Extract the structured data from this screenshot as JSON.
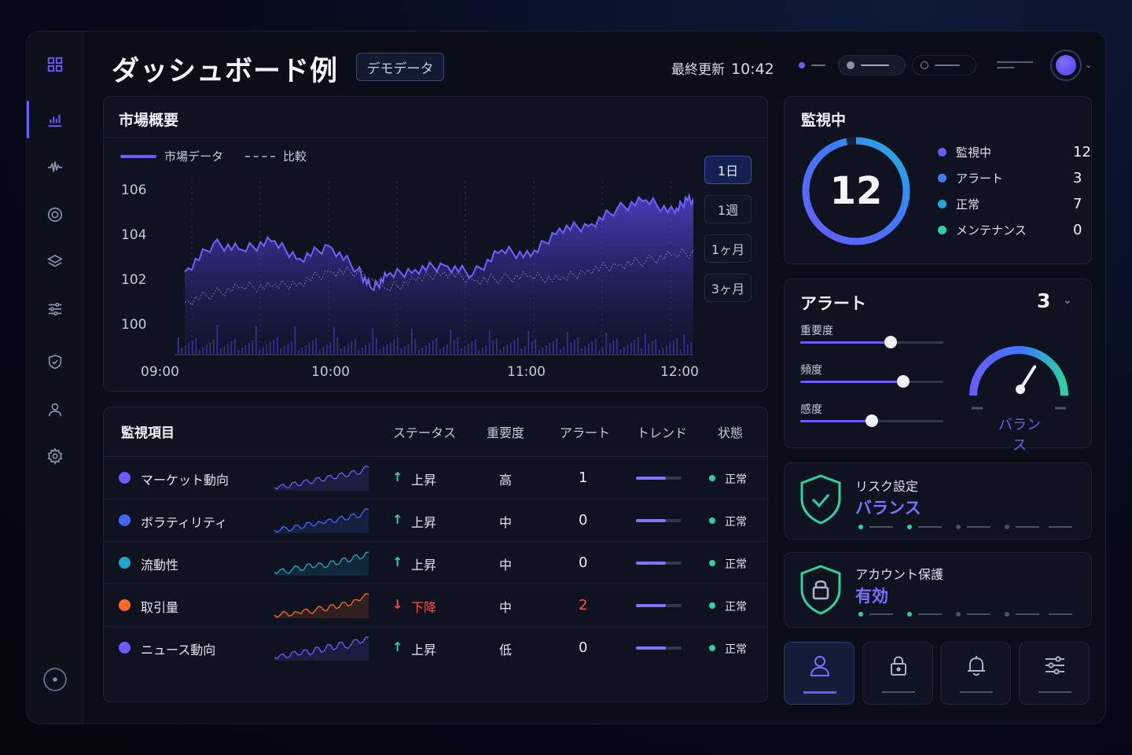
{
  "header": {
    "title": "ダッシュボード例",
    "badge": "デモデータ",
    "updated_label": "最終更新",
    "updated_time": "10:42"
  },
  "market": {
    "title": "市場概要",
    "legend": [
      {
        "label": "市場データ",
        "color": "#6a5cff"
      },
      {
        "label": "比較",
        "color": "#8a90a8"
      }
    ],
    "ranges": [
      "1日",
      "1週",
      "1ヶ月",
      "3ヶ月"
    ],
    "active_range": "1日"
  },
  "chart_data": {
    "type": "area",
    "x_ticks": [
      "09:00",
      "10:00",
      "11:00",
      "12:00"
    ],
    "y_ticks": [
      "100",
      "102",
      "104",
      "106"
    ],
    "ylim": [
      98.6,
      107.2
    ],
    "grid": true,
    "legend_position": "top-left",
    "series": [
      {
        "name": "市場データ",
        "color": "#6a5cff",
        "x": [
          "09:00",
          "09:10",
          "09:20",
          "09:30",
          "09:40",
          "09:50",
          "10:00",
          "10:05",
          "10:10",
          "10:20",
          "10:30",
          "10:40",
          "10:50",
          "11:00",
          "11:10",
          "11:20",
          "11:30",
          "11:40",
          "11:50",
          "11:55",
          "12:00",
          "12:05"
        ],
        "values": [
          102.3,
          103.6,
          103.3,
          103.7,
          102.9,
          103.5,
          102.4,
          101.5,
          102.1,
          102.4,
          102.6,
          102.2,
          103.3,
          103.0,
          104.3,
          104.4,
          105.2,
          105.6,
          105.0,
          105.8,
          104.5,
          105.1
        ]
      },
      {
        "name": "比較",
        "color": "#8a90a8",
        "x": [
          "09:00",
          "09:10",
          "09:20",
          "09:30",
          "09:40",
          "09:50",
          "10:00",
          "10:10",
          "10:20",
          "10:30",
          "10:40",
          "10:50",
          "11:00",
          "11:10",
          "11:20",
          "11:30",
          "11:40",
          "11:50",
          "12:00",
          "12:05"
        ],
        "values": [
          100.9,
          101.3,
          101.6,
          101.6,
          101.8,
          102.3,
          102.3,
          101.5,
          101.9,
          102.3,
          101.9,
          102.0,
          102.1,
          101.9,
          102.4,
          102.6,
          102.8,
          103.1,
          103.2,
          103.8
        ]
      }
    ]
  },
  "table": {
    "title": "監視項目",
    "headers": [
      "ステータス",
      "重要度",
      "アラート",
      "トレンド",
      "状態"
    ],
    "rows": [
      {
        "name": "マーケット動向",
        "color": "#6a5cff",
        "arrow": "↑",
        "status": "上昇",
        "status_color": "#e6e9f2",
        "arrow_color": "#2ed1a4",
        "importance": "高",
        "alerts": "1",
        "alert_color": "#e6e9f2",
        "state": "正常",
        "spark": [
          3,
          4,
          3,
          5,
          4,
          6,
          5,
          7,
          6,
          8,
          7,
          9,
          8,
          10,
          9,
          11,
          12
        ]
      },
      {
        "name": "ボラティリティ",
        "color": "#4466ff",
        "arrow": "↑",
        "status": "上昇",
        "status_color": "#e6e9f2",
        "arrow_color": "#2ed1a4",
        "importance": "中",
        "alerts": "0",
        "alert_color": "#e6e9f2",
        "state": "正常",
        "spark": [
          3,
          3,
          4,
          3,
          5,
          4,
          6,
          5,
          6,
          7,
          6,
          8,
          7,
          9,
          8,
          10,
          11
        ]
      },
      {
        "name": "流動性",
        "color": "#1fa6c9",
        "arrow": "↑",
        "status": "上昇",
        "status_color": "#e6e9f2",
        "arrow_color": "#2ed1a4",
        "importance": "中",
        "alerts": "0",
        "alert_color": "#e6e9f2",
        "state": "正常",
        "spark": [
          3,
          4,
          3,
          4,
          5,
          4,
          6,
          5,
          6,
          5,
          7,
          6,
          8,
          7,
          9,
          8,
          10
        ]
      },
      {
        "name": "取引量",
        "color": "#ff6a2a",
        "arrow": "↓",
        "status": "下降",
        "status_color": "#ff4d4d",
        "arrow_color": "#ff4d4d",
        "importance": "中",
        "alerts": "2",
        "alert_color": "#ff4d4d",
        "state": "正常",
        "spark": [
          3,
          3,
          4,
          3,
          4,
          5,
          4,
          5,
          6,
          5,
          7,
          6,
          8,
          7,
          9,
          10,
          11
        ]
      },
      {
        "name": "ニュース動向",
        "color": "#6a5cff",
        "arrow": "↑",
        "status": "上昇",
        "status_color": "#e6e9f2",
        "arrow_color": "#2ed1a4",
        "importance": "低",
        "alerts": "0",
        "alert_color": "#e6e9f2",
        "state": "正常",
        "spark": [
          3,
          4,
          3,
          5,
          4,
          6,
          4,
          7,
          5,
          8,
          6,
          9,
          7,
          8,
          10,
          9,
          11
        ]
      }
    ]
  },
  "monitor": {
    "title": "監視中",
    "total": "12",
    "items": [
      {
        "label": "監視中",
        "value": "12",
        "color": "#6a5cff"
      },
      {
        "label": "アラート",
        "value": "3",
        "color": "#3d7bff"
      },
      {
        "label": "正常",
        "value": "7",
        "color": "#1fa6e0"
      },
      {
        "label": "メンテナンス",
        "value": "0",
        "color": "#2ed1a4"
      }
    ]
  },
  "alert": {
    "title": "アラート",
    "count": "3",
    "sliders": [
      {
        "label": "重要度",
        "value": 0.63
      },
      {
        "label": "頻度",
        "value": 0.72
      },
      {
        "label": "感度",
        "value": 0.5
      }
    ],
    "gauge_label": "バランス",
    "gauge_value": 0.65
  },
  "security": [
    {
      "title": "リスク設定",
      "value": "バランス",
      "icon": "shield-check-icon"
    },
    {
      "title": "アカウント保護",
      "value": "有効",
      "icon": "shield-lock-icon"
    }
  ],
  "bottom_nav": [
    {
      "icon": "user-icon",
      "active": true
    },
    {
      "icon": "lock-icon",
      "active": false
    },
    {
      "icon": "bell-icon",
      "active": false
    },
    {
      "icon": "sliders-icon",
      "active": false
    }
  ]
}
